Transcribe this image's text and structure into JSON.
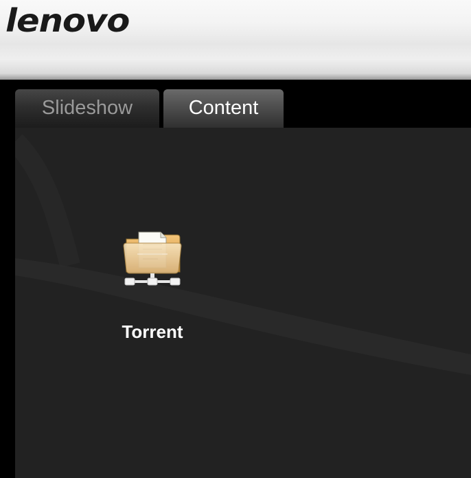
{
  "header": {
    "logo_text": "lenovo"
  },
  "tabs": [
    {
      "label": "Slideshow",
      "active": false
    },
    {
      "label": "Content",
      "active": true
    }
  ],
  "content": {
    "items": [
      {
        "label": "Torrent",
        "icon": "network-folder-icon"
      }
    ]
  },
  "colors": {
    "panel_background": "#222222",
    "active_tab_text": "#ffffff",
    "inactive_tab_text": "#9a9a9a"
  }
}
